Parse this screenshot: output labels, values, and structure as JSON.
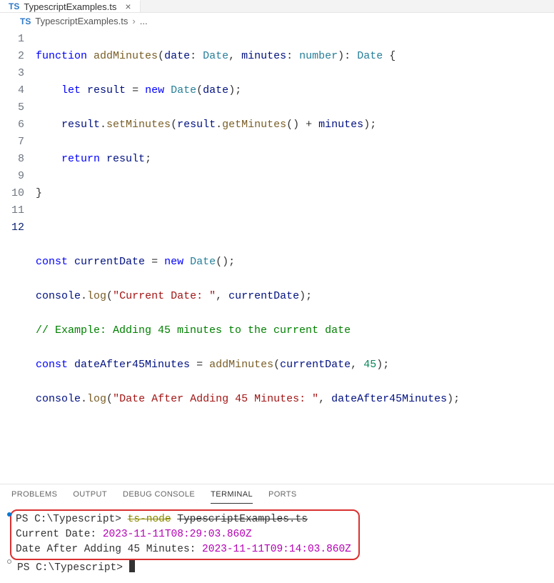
{
  "tab": {
    "icon": "TS",
    "filename": "TypescriptExamples.ts"
  },
  "breadcrumb": {
    "icon": "TS",
    "filename": "TypescriptExamples.ts",
    "sep": "›",
    "ellipsis": "..."
  },
  "lines": [
    "1",
    "2",
    "3",
    "4",
    "5",
    "6",
    "7",
    "8",
    "9",
    "10",
    "11",
    "12"
  ],
  "code": {
    "l1": {
      "kw_function": "function",
      "fn": "addMinutes",
      "p1": "date",
      "t1": "Date",
      "p2": "minutes",
      "t2": "number",
      "ret": "Date",
      "brace": "{"
    },
    "l2": {
      "kw_let": "let",
      "var": "result",
      "eq": "=",
      "kw_new": "new",
      "ctor": "Date",
      "arg": "date"
    },
    "l3": {
      "obj": "result",
      "m1": "setMinutes",
      "obj2": "result",
      "m2": "getMinutes",
      "plus": "+",
      "arg": "minutes"
    },
    "l4": {
      "kw_return": "return",
      "var": "result"
    },
    "l5": {
      "brace": "}"
    },
    "l7": {
      "kw_const": "const",
      "var": "currentDate",
      "eq": "=",
      "kw_new": "new",
      "ctor": "Date"
    },
    "l8": {
      "obj": "console",
      "m": "log",
      "str": "\"Current Date: \"",
      "arg": "currentDate"
    },
    "l9": {
      "cmt": "// Example: Adding 45 minutes to the current date"
    },
    "l10": {
      "kw_const": "const",
      "var": "dateAfter45Minutes",
      "eq": "=",
      "fn": "addMinutes",
      "a1": "currentDate",
      "a2": "45"
    },
    "l11": {
      "obj": "console",
      "m": "log",
      "str": "\"Date After Adding 45 Minutes: \"",
      "arg": "dateAfter45Minutes"
    }
  },
  "panel": {
    "tabs": {
      "problems": "PROBLEMS",
      "output": "OUTPUT",
      "debug": "DEBUG CONSOLE",
      "terminal": "TERMINAL",
      "ports": "PORTS"
    }
  },
  "terminal": {
    "prompt1": "PS C:\\Typescript>",
    "cmd": "ts-node",
    "arg": "TypescriptExamples.ts",
    "out1_label": "Current Date:  ",
    "out1_value": "2023-11-11T08:29:03.860Z",
    "out2_label": "Date After Adding 45 Minutes:  ",
    "out2_value": "2023-11-11T09:14:03.860Z",
    "prompt2": "PS C:\\Typescript>"
  }
}
